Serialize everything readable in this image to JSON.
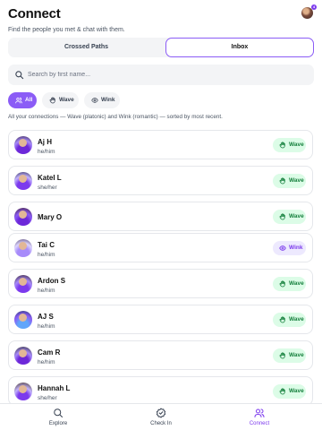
{
  "header": {
    "title": "Connect",
    "subtitle": "Find the people you met & chat with them.",
    "notification_count": "4"
  },
  "tabs": [
    {
      "label": "Crossed Paths",
      "active": false
    },
    {
      "label": "Inbox",
      "active": true
    }
  ],
  "search": {
    "placeholder": "Search by first name...",
    "value": ""
  },
  "filters": [
    {
      "label": "All",
      "icon": "users-icon",
      "active": true
    },
    {
      "label": "Wave",
      "icon": "wave-hand-icon",
      "active": false
    },
    {
      "label": "Wink",
      "icon": "eye-icon",
      "active": false
    }
  ],
  "note": "All your connections — Wave (platonic) and Wink (romantic) — sorted by most recent.",
  "connections": [
    {
      "name": "Aj H",
      "pronouns": "he/him",
      "action": "Wave"
    },
    {
      "name": "Katel L",
      "pronouns": "she/her",
      "action": "Wave"
    },
    {
      "name": "Mary O",
      "pronouns": "",
      "action": "Wave"
    },
    {
      "name": "Tai C",
      "pronouns": "he/him",
      "action": "Wink"
    },
    {
      "name": "Ardon S",
      "pronouns": "he/him",
      "action": "Wave"
    },
    {
      "name": "AJ S",
      "pronouns": "he/him",
      "action": "Wave"
    },
    {
      "name": "Cam R",
      "pronouns": "he/him",
      "action": "Wave"
    },
    {
      "name": "Hannah L",
      "pronouns": "she/her",
      "action": "Wave"
    }
  ],
  "bottom_nav": [
    {
      "label": "Explore",
      "icon": "search-icon",
      "active": false
    },
    {
      "label": "Check In",
      "icon": "check-badge-icon",
      "active": false
    },
    {
      "label": "Connect",
      "icon": "users-icon",
      "active": true
    }
  ],
  "colors": {
    "accent": "#8b5cf6",
    "wave_bg": "#dcfce7",
    "wave_text": "#15803d",
    "wink_bg": "#ede9fe",
    "wink_text": "#7c3aed"
  }
}
